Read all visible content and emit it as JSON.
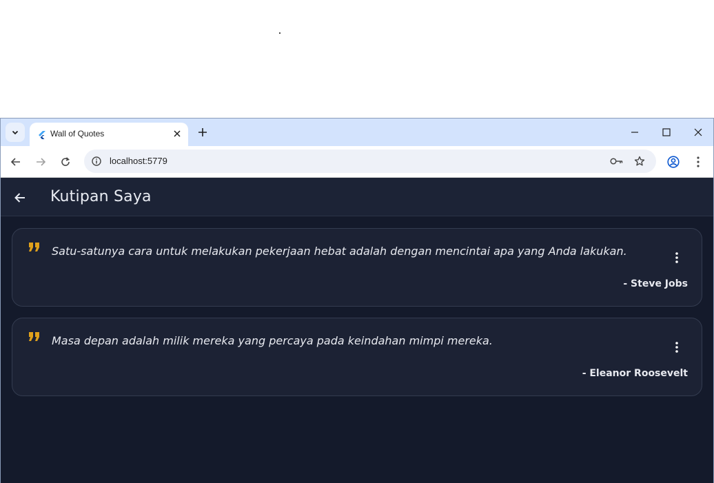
{
  "browser": {
    "tab_title": "Wall of Quotes",
    "url": "localhost:5779"
  },
  "app": {
    "title": "Kutipan Saya",
    "accent_color": "#e0a11b",
    "quotes": [
      {
        "text": "Satu-satunya cara untuk melakukan pekerjaan hebat adalah dengan mencintai apa yang Anda lakukan.",
        "author": "- Steve Jobs"
      },
      {
        "text": "Masa depan adalah milik mereka yang percaya pada keindahan mimpi mereka.",
        "author": "- Eleanor Roosevelt"
      }
    ]
  },
  "icons": {
    "tab_search": "chevron-down-icon",
    "favicon": "flutter-icon",
    "tab_close": "close-icon",
    "new_tab": "plus-icon",
    "minimize": "minimize-icon",
    "maximize": "maximize-icon",
    "window_close": "close-icon",
    "back": "arrow-left-icon",
    "forward": "arrow-right-icon",
    "reload": "reload-icon",
    "site_info": "info-icon",
    "password": "key-icon",
    "bookmark": "star-icon",
    "profile": "profile-icon",
    "browser_menu": "kebab-menu-icon",
    "app_back": "arrow-left-icon",
    "quote": "quote-icon",
    "card_menu": "kebab-menu-icon"
  }
}
